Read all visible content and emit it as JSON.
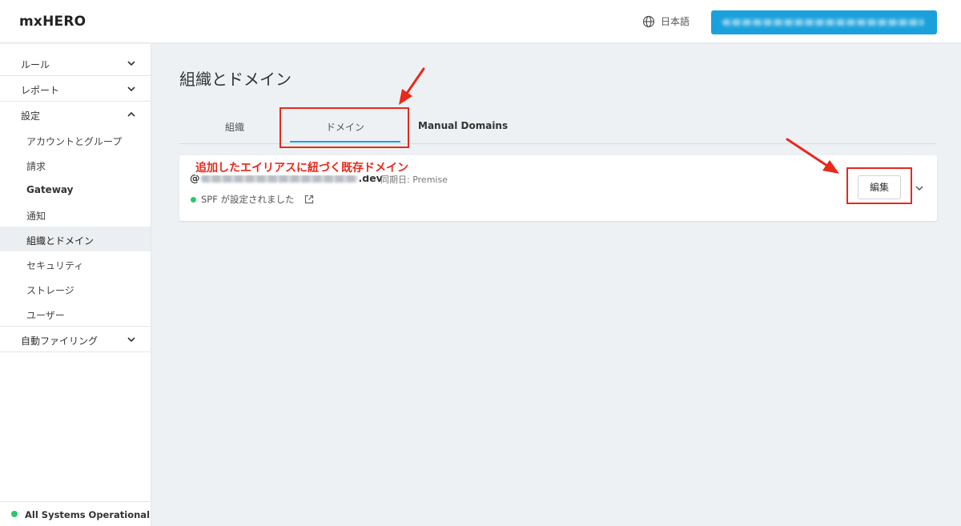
{
  "app": {
    "title": "mxHERO"
  },
  "header": {
    "language": "日本語"
  },
  "sidebar": {
    "rules": "ルール",
    "reports": "レポート",
    "settings": "設定",
    "settings_items": [
      "アカウントとグループ",
      "請求",
      "Gateway",
      "通知",
      "組織とドメイン",
      "セキュリティ",
      "ストレージ",
      "ユーザー"
    ],
    "auto_filing": "自動ファイリング",
    "status": "All Systems Operational"
  },
  "main": {
    "title": "組織とドメイン",
    "tabs": [
      "組織",
      "ドメイン",
      "Manual Domains"
    ],
    "active_tab": "ドメイン",
    "domain": {
      "prefix": "@",
      "suffix": ".dev",
      "sync": "同期日: Premise",
      "spf": "SPF が設定されました"
    },
    "edit_button": "編集"
  },
  "annotation": {
    "text": "追加したエイリアスに紐づく既存ドメイン"
  },
  "colors": {
    "accent": "#1aa1dc",
    "annotation": "#e8291c",
    "status_ok": "#2dc76d"
  }
}
